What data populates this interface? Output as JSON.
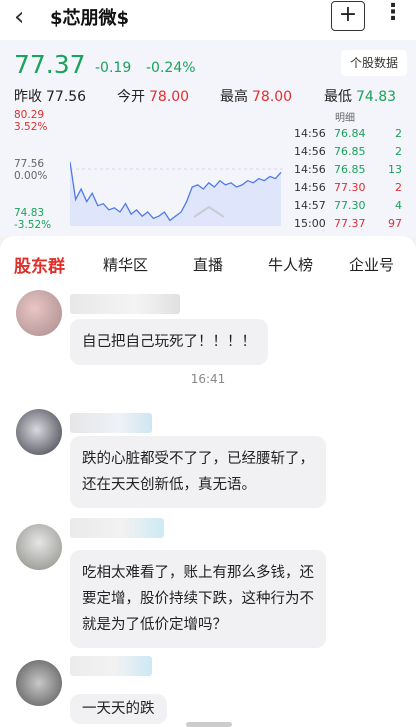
{
  "header": {
    "back_icon": "chevron-left-icon",
    "title": "$芯朋微$",
    "add_label": "+",
    "more_label": "⋮"
  },
  "quote": {
    "price": "77.37",
    "change": "-0.19",
    "change_pct": "-0.24%",
    "data_button": "个股数据",
    "prev_close_label": "昨收",
    "prev_close": "77.56",
    "open_label": "今开",
    "open": "78.00",
    "high_label": "最高",
    "high": "78.00",
    "low_label": "最低",
    "low": "74.83"
  },
  "chart_axis": {
    "top_price": "80.29",
    "top_pct": "3.52%",
    "mid_price": "77.56",
    "mid_pct": "0.00%",
    "bot_price": "74.83",
    "bot_pct": "-3.52%"
  },
  "chart_data": {
    "type": "area",
    "ylim": [
      74.83,
      80.29
    ],
    "baseline": 77.56,
    "values": [
      77.9,
      76.1,
      76.6,
      76.0,
      76.4,
      75.8,
      75.9,
      75.6,
      75.7,
      75.5,
      75.9,
      75.4,
      75.6,
      75.3,
      75.5,
      75.2,
      75.3,
      75.5,
      75.1,
      75.3,
      75.5,
      76.0,
      76.7,
      76.8,
      76.6,
      76.9,
      76.7,
      77.0,
      76.8,
      76.9,
      76.7,
      76.8,
      77.0,
      76.9,
      77.1,
      77.0,
      77.2,
      77.1,
      77.4
    ]
  },
  "ticks": {
    "header": "明细",
    "rows": [
      {
        "time": "14:56",
        "price": "76.84",
        "qty": "2",
        "color": "green"
      },
      {
        "time": "14:56",
        "price": "76.85",
        "qty": "2",
        "color": "green"
      },
      {
        "time": "14:56",
        "price": "76.85",
        "qty": "13",
        "color": "green"
      },
      {
        "time": "14:56",
        "price": "77.30",
        "qty": "2",
        "color": "red"
      },
      {
        "time": "14:57",
        "price": "77.30",
        "qty": "4",
        "color": "green"
      },
      {
        "time": "15:00",
        "price": "77.37",
        "qty": "97",
        "color": "red"
      }
    ]
  },
  "tabs": [
    "股东群",
    "精华区",
    "直播",
    "牛人榜",
    "企业号"
  ],
  "chat": {
    "time_divider": "16:41",
    "messages": [
      "自己把自己玩死了！！！！",
      "跌的心脏都受不了了，已经腰斩了，\n还在天天创新低，真无语。",
      "吃相太难看了，账上有那么多钱，还\n要定增，股价持续下跌，这种行为不\n就是为了低价定增吗？",
      "一天天的跌"
    ]
  },
  "colors": {
    "up": "#e03030",
    "down": "#1aa35a",
    "accent": "#e0302a"
  }
}
